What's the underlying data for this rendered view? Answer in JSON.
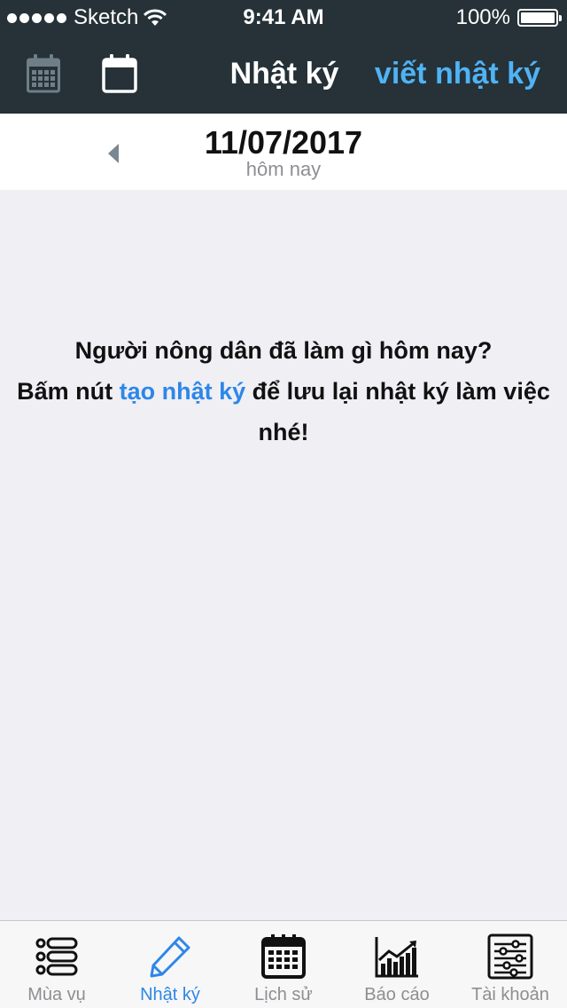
{
  "status_bar": {
    "carrier": "Sketch",
    "time": "9:41 AM",
    "battery": "100%"
  },
  "nav": {
    "title": "Nhật ký",
    "action": "viết nhật ký"
  },
  "date_bar": {
    "date": "11/07/2017",
    "subtitle": "hôm nay"
  },
  "empty_state": {
    "line1": "Người nông dân đã làm gì hôm nay?",
    "prefix": "Bấm nút ",
    "link": "tạo nhật ký",
    "suffix": " để lưu lại nhật ký làm việc",
    "line3": "nhé!"
  },
  "tabs": [
    {
      "label": "Mùa vụ",
      "icon": "list-icon",
      "active": false
    },
    {
      "label": "Nhật ký",
      "icon": "pencil-icon",
      "active": true
    },
    {
      "label": "Lịch sử",
      "icon": "calendar-icon",
      "active": false
    },
    {
      "label": "Báo cáo",
      "icon": "chart-icon",
      "active": false
    },
    {
      "label": "Tài khoản",
      "icon": "sliders-icon",
      "active": false
    }
  ],
  "colors": {
    "nav_bg": "#263238",
    "accent": "#4fb3f6",
    "link": "#2d87e8",
    "background": "#efeff4"
  }
}
